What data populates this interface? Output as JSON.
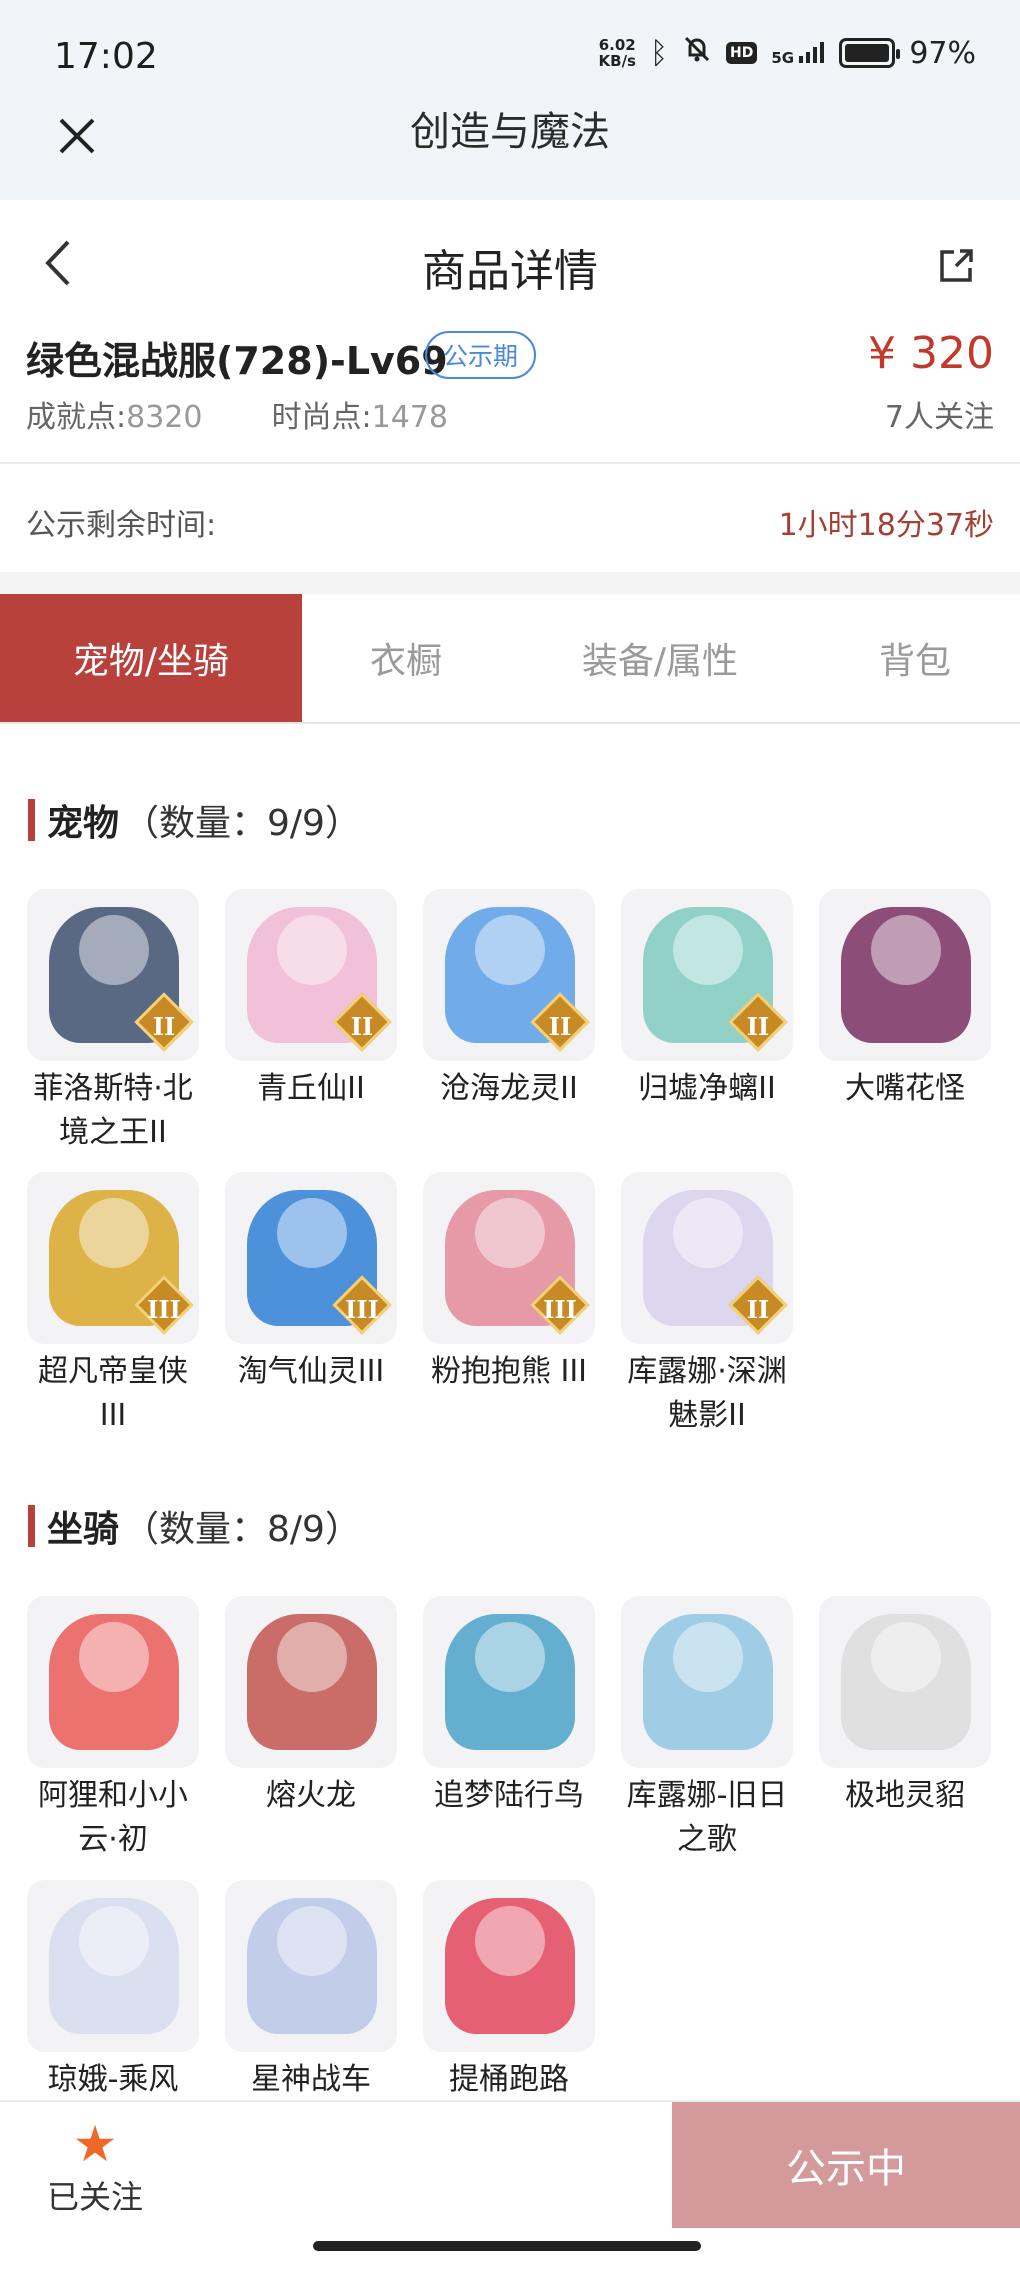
{
  "status_bar": {
    "time": "17:02",
    "net_speed_top": "6.02",
    "net_speed_bottom": "KB/s",
    "hd": "HD",
    "network": "5G",
    "battery": "97%"
  },
  "app": {
    "title": "创造与魔法"
  },
  "nav": {
    "title": "商品详情"
  },
  "item": {
    "name": "绿色混战服(728)-Lv69",
    "badge": "公示期",
    "price": "¥ 320",
    "achievement_label": "成就点:",
    "achievement_value": "8320",
    "fashion_label": "时尚点:",
    "fashion_value": "1478",
    "watchers": "7人关注"
  },
  "countdown": {
    "label": "公示剩余时间:",
    "value": "1小时18分37秒"
  },
  "tabs": [
    {
      "label": "宠物/坐骑",
      "active": true
    },
    {
      "label": "衣橱",
      "active": false
    },
    {
      "label": "装备/属性",
      "active": false
    },
    {
      "label": "背包",
      "active": false
    }
  ],
  "pets": {
    "title": "宠物",
    "count": "（数量：9/9）",
    "items": [
      {
        "name": "菲洛斯特·北境之王II",
        "rank": "II",
        "color": "#3d4f6e"
      },
      {
        "name": "青丘仙II",
        "rank": "II",
        "color": "#f0b6d3"
      },
      {
        "name": "沧海龙灵II",
        "rank": "II",
        "color": "#5a9de6"
      },
      {
        "name": "归墟净螭II",
        "rank": "II",
        "color": "#7fcac0"
      },
      {
        "name": "大嘴花怪",
        "rank": "",
        "color": "#7a2f63"
      },
      {
        "name": "超凡帝皇侠III",
        "rank": "III",
        "color": "#d8a628"
      },
      {
        "name": "淘气仙灵III",
        "rank": "III",
        "color": "#2f7fd6"
      },
      {
        "name": "粉抱抱熊 III",
        "rank": "III",
        "color": "#e38a9a"
      },
      {
        "name": "库露娜·深渊魅影II",
        "rank": "II",
        "color": "#d7d0ec"
      }
    ]
  },
  "mounts": {
    "title": "坐骑",
    "count": "（数量：8/9）",
    "items": [
      {
        "name": "阿狸和小小云·初",
        "rank": "",
        "color": "#ea5a57"
      },
      {
        "name": "熔火龙",
        "rank": "",
        "color": "#c2534f"
      },
      {
        "name": "追梦陆行鸟",
        "rank": "",
        "color": "#4aa2c9"
      },
      {
        "name": "库露娜-旧日之歌",
        "rank": "",
        "color": "#8fc6e3"
      },
      {
        "name": "极地灵貂",
        "rank": "",
        "color": "#dcdcdc"
      },
      {
        "name": "琼娥-乘风",
        "rank": "",
        "color": "#d6dcef"
      },
      {
        "name": "星神战车",
        "rank": "",
        "color": "#b9c6e8"
      },
      {
        "name": "提桶跑路",
        "rank": "",
        "color": "#e2455a"
      }
    ]
  },
  "bottom": {
    "follow_label": "已关注",
    "cta_label": "公示中"
  },
  "colors": {
    "accent": "#b8413b",
    "price": "#c0392b",
    "badge": "#4a8ad8",
    "cta": "#d4999a",
    "star": "#f0672a"
  }
}
